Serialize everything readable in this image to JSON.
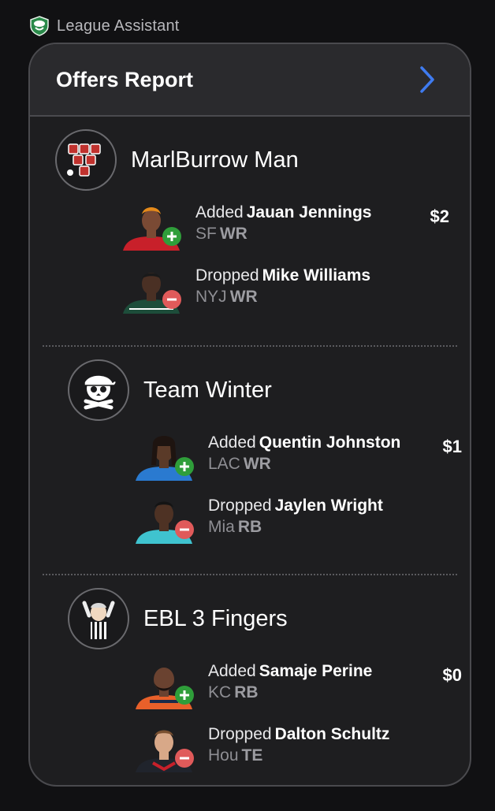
{
  "app": {
    "name": "League Assistant"
  },
  "card": {
    "title": "Offers Report"
  },
  "teams": [
    {
      "name": "MarlBurrow Man",
      "added": {
        "action": "Added",
        "player": "Jauan Jennings",
        "team": "SF",
        "pos": "WR",
        "price": "$2"
      },
      "dropped": {
        "action": "Dropped",
        "player": "Mike Williams",
        "team": "NYJ",
        "pos": "WR"
      }
    },
    {
      "name": "Team Winter",
      "added": {
        "action": "Added",
        "player": "Quentin Johnston",
        "team": "LAC",
        "pos": "WR",
        "price": "$1"
      },
      "dropped": {
        "action": "Dropped",
        "player": "Jaylen Wright",
        "team": "Mia",
        "pos": "RB"
      }
    },
    {
      "name": "EBL 3 Fingers",
      "added": {
        "action": "Added",
        "player": "Samaje Perine",
        "team": "KC",
        "pos": "RB",
        "price": "$0"
      },
      "dropped": {
        "action": "Dropped",
        "player": "Dalton Schultz",
        "team": "Hou",
        "pos": "TE"
      }
    }
  ],
  "colors": {
    "accent": "#3f7bf0",
    "add": "#2f9e3a",
    "drop": "#e05a5a",
    "card_bg": "#1e1e20",
    "header_bg": "#2a2a2d"
  },
  "icons": {
    "app_logo": "football-shield-icon",
    "chevron": "chevron-right-icon",
    "add_badge": "plus-circle-icon",
    "drop_badge": "minus-circle-icon",
    "team1_avatar": "beer-pong-cups-icon",
    "team2_avatar": "pirate-skull-icon",
    "team3_avatar": "referee-icon"
  }
}
